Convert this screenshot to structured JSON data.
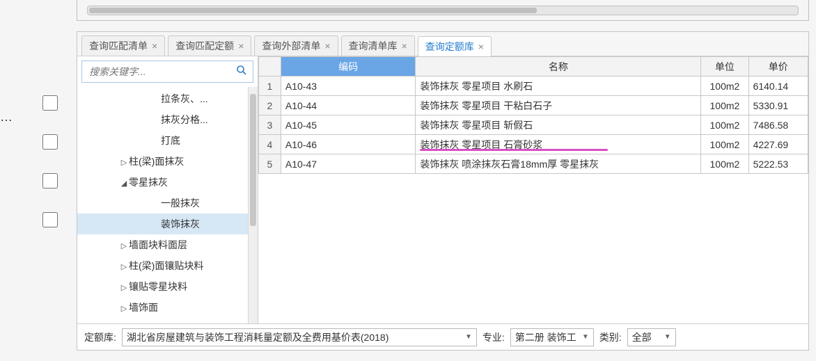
{
  "tabs": [
    {
      "label": "查询匹配清单",
      "active": false
    },
    {
      "label": "查询匹配定额",
      "active": false
    },
    {
      "label": "查询外部清单",
      "active": false
    },
    {
      "label": "查询清单库",
      "active": false
    },
    {
      "label": "查询定额库",
      "active": true
    }
  ],
  "search": {
    "placeholder": "搜索关键字..."
  },
  "tree": [
    {
      "indent": 120,
      "toggle": "",
      "label": "拉条灰、..."
    },
    {
      "indent": 120,
      "toggle": "",
      "label": "抹灰分格..."
    },
    {
      "indent": 120,
      "toggle": "",
      "label": "打底"
    },
    {
      "indent": 60,
      "toggle": "▷",
      "label": "柱(梁)面抹灰"
    },
    {
      "indent": 60,
      "toggle": "◢",
      "label": "零星抹灰"
    },
    {
      "indent": 120,
      "toggle": "",
      "label": "一般抹灰"
    },
    {
      "indent": 120,
      "toggle": "",
      "label": "装饰抹灰",
      "selected": true
    },
    {
      "indent": 60,
      "toggle": "▷",
      "label": "墙面块料面层"
    },
    {
      "indent": 60,
      "toggle": "▷",
      "label": "柱(梁)面镶贴块料"
    },
    {
      "indent": 60,
      "toggle": "▷",
      "label": "镶贴零星块料"
    },
    {
      "indent": 60,
      "toggle": "▷",
      "label": "墙饰面"
    }
  ],
  "table": {
    "headers": {
      "code": "编码",
      "name": "名称",
      "unit": "单位",
      "price": "单价"
    },
    "rows": [
      {
        "idx": "1",
        "code": "A10-43",
        "name": "装饰抹灰 零星项目 水刷石",
        "unit": "100m2",
        "price": "6140.14"
      },
      {
        "idx": "2",
        "code": "A10-44",
        "name": "装饰抹灰 零星项目 干粘白石子",
        "unit": "100m2",
        "price": "5330.91"
      },
      {
        "idx": "3",
        "code": "A10-45",
        "name": "装饰抹灰 零星项目 斩假石",
        "unit": "100m2",
        "price": "7486.58"
      },
      {
        "idx": "4",
        "code": "A10-46",
        "name": "装饰抹灰 零星项目 石膏砂浆",
        "unit": "100m2",
        "price": "4227.69",
        "highlight": true
      },
      {
        "idx": "5",
        "code": "A10-47",
        "name": "装饰抹灰 喷涂抹灰石膏18mm厚 零星抹灰",
        "unit": "100m2",
        "price": "5222.53"
      }
    ]
  },
  "bottom": {
    "lib_label": "定额库:",
    "lib_value": "湖北省房屋建筑与装饰工程消耗量定额及全费用基价表(2018)",
    "major_label": "专业:",
    "major_value": "第二册 装饰工",
    "cat_label": "类别:",
    "cat_value": "全部"
  }
}
